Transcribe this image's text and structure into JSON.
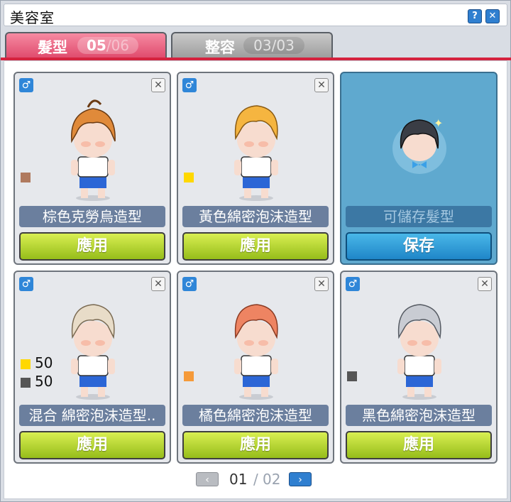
{
  "window": {
    "title": "美容室"
  },
  "tabs": [
    {
      "label": "髮型",
      "current": "05",
      "total": "06",
      "active": true
    },
    {
      "label": "整容",
      "current": "03",
      "total": "03",
      "active": false
    }
  ],
  "cards": [
    {
      "name": "棕色克勞烏造型",
      "button": "應用",
      "gender_icon": "male-icon",
      "hair_color": "#e08a3a",
      "swatch": "#b07a5e"
    },
    {
      "name": "黃色綿密泡沫造型",
      "button": "應用",
      "gender_icon": "male-icon",
      "hair_color": "#f5b540",
      "swatch": "#ffd800"
    },
    {
      "name": "可儲存髮型",
      "button": "保存",
      "gender_icon": "male-icon",
      "saved_slot": true
    },
    {
      "name": "混合 綿密泡沫造型..",
      "button": "應用",
      "gender_icon": "male-icon",
      "hair_color": "#e8dcc8",
      "mix": [
        {
          "color": "#ffd800",
          "value": "50"
        },
        {
          "color": "#555555",
          "value": "50"
        }
      ]
    },
    {
      "name": "橘色綿密泡沫造型",
      "button": "應用",
      "gender_icon": "male-icon",
      "hair_color": "#ee8462",
      "swatch": "#f59a3a"
    },
    {
      "name": "黑色綿密泡沫造型",
      "button": "應用",
      "gender_icon": "male-icon",
      "hair_color": "#c9ccd3",
      "swatch": "#555555"
    }
  ],
  "pager": {
    "current": "01",
    "separator": "/",
    "total": "02"
  },
  "icons": {
    "help": "help-icon",
    "close": "close-icon",
    "remove": "close-icon",
    "prev": "chevron-left-icon",
    "next": "chevron-right-icon"
  }
}
